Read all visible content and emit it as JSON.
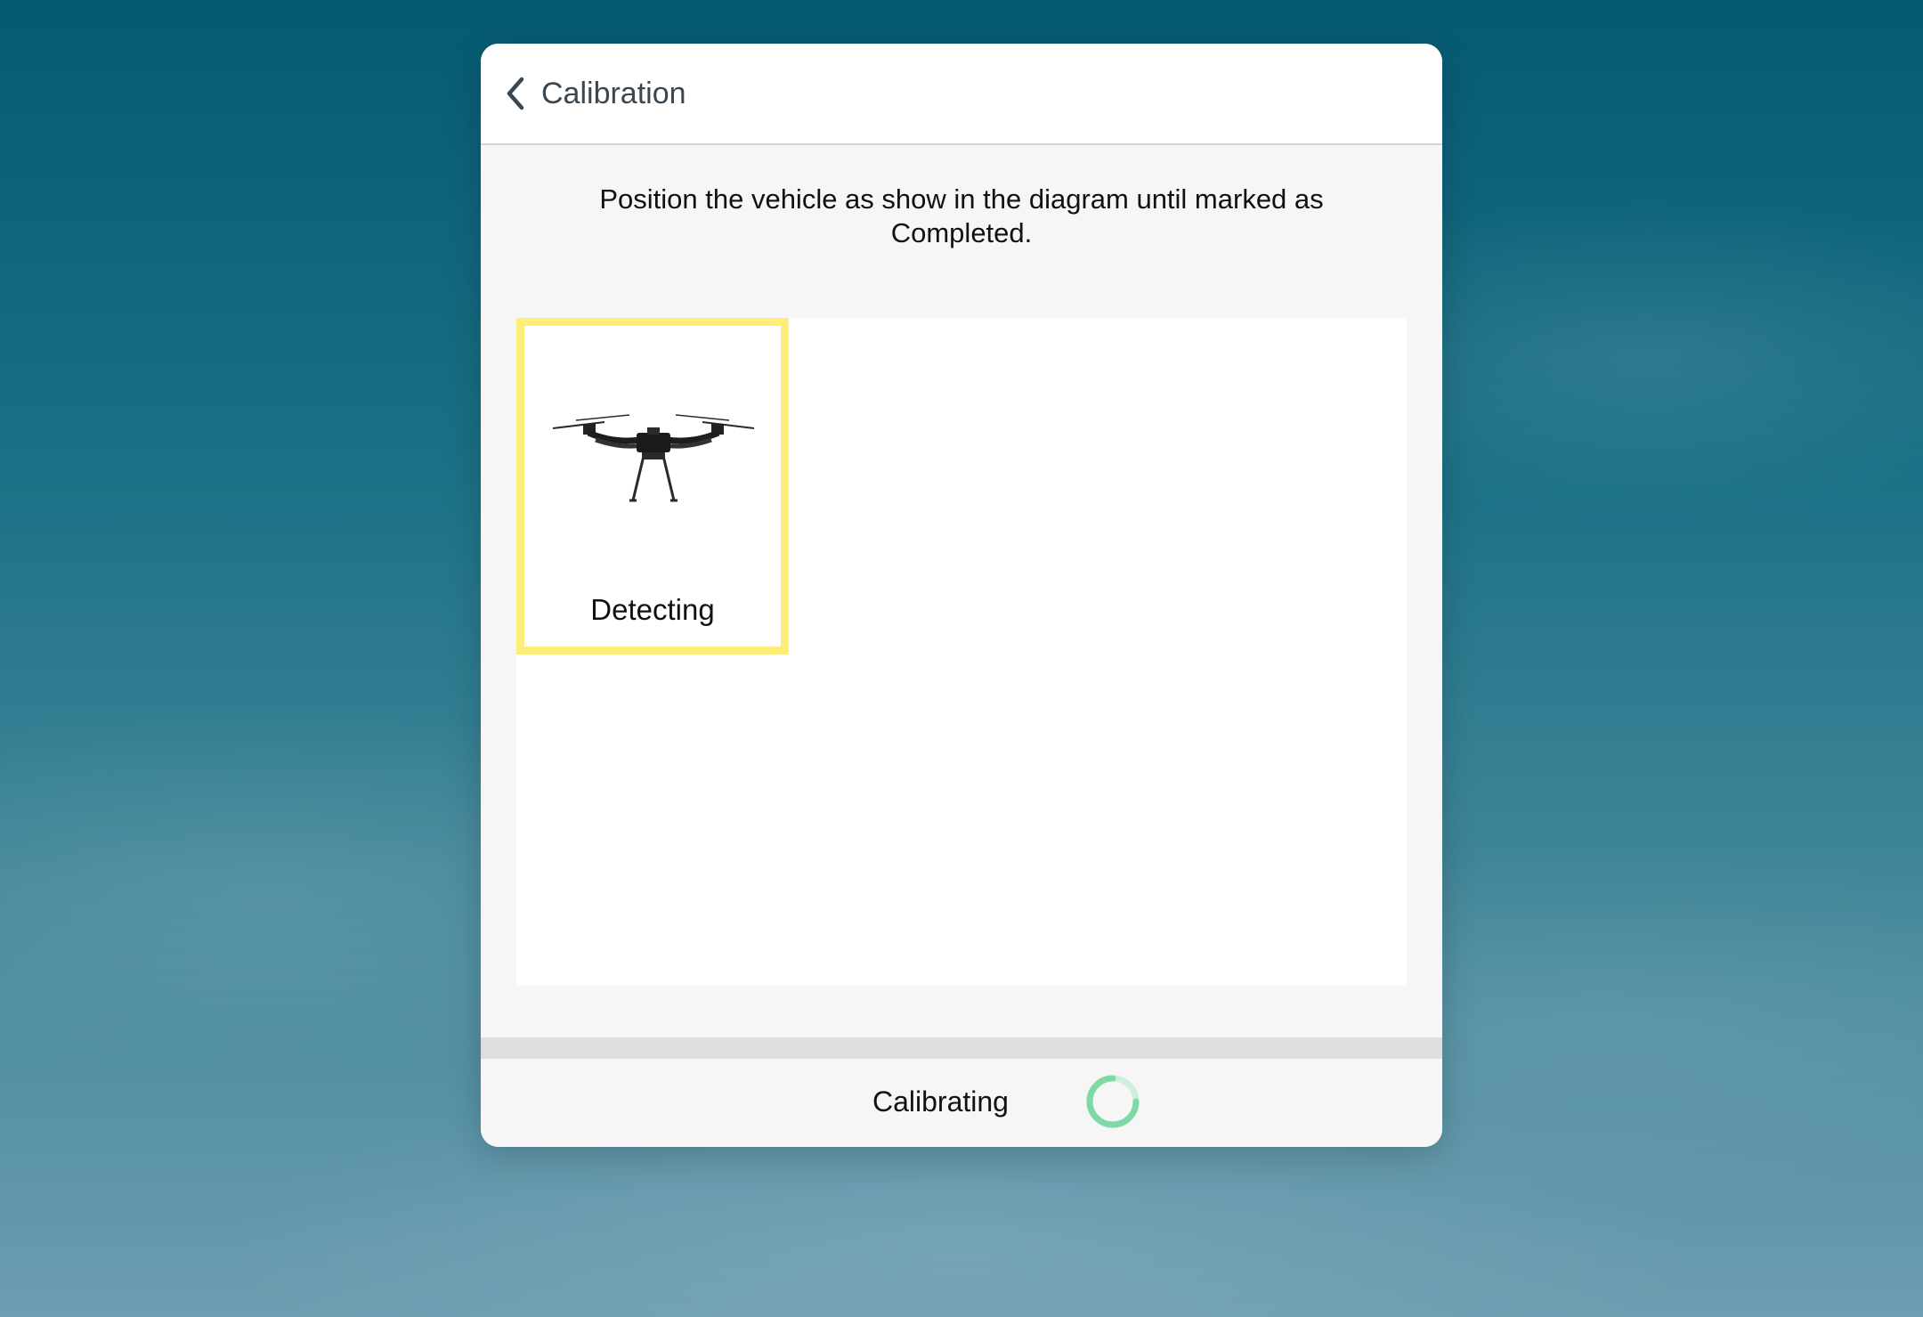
{
  "header": {
    "back_label": "Calibration"
  },
  "instructions": "Position the vehicle as show in the diagram until marked as Completed.",
  "steps": [
    {
      "label": "Detecting",
      "state_color": "#fcee78"
    }
  ],
  "footer": {
    "status": "Calibrating",
    "spinner_color": "#7ed9a6"
  },
  "icons": {
    "back": "chevron-left-icon",
    "vehicle": "drone-image",
    "progress": "spinner-icon"
  }
}
